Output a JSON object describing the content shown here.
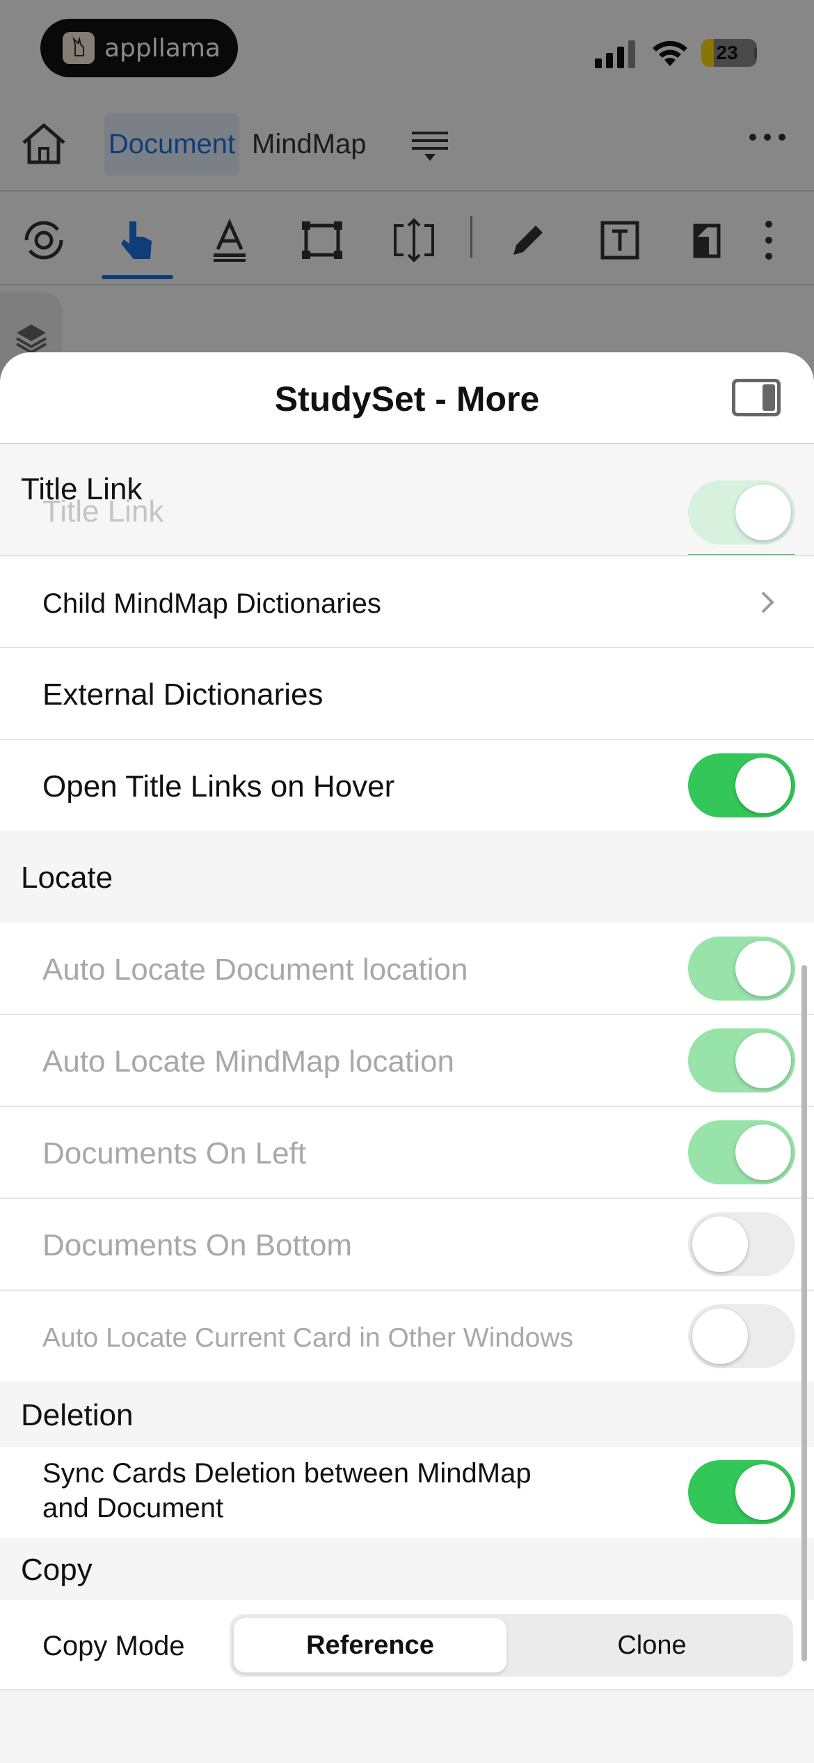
{
  "status": {
    "app_pill": "appllama",
    "battery": "23",
    "colors": {
      "battery_level": "#ffd60a"
    }
  },
  "nav": {
    "tab_document": "Document",
    "tab_mindmap": "MindMap",
    "icons": [
      "home-icon",
      "list-icon",
      "more-icon"
    ]
  },
  "toolbar": {
    "icons": [
      "settings-cycle-icon",
      "pointer-hand-icon",
      "text-highlight-icon",
      "rect-select-icon",
      "resize-icon",
      "pencil-icon",
      "text-box-icon",
      "eraser-icon",
      "more-vertical-icon"
    ],
    "accent": "#1f6fdc"
  },
  "sheet": {
    "title": "StudySet - More",
    "sections": {
      "title_link": "Title Link",
      "locate": "Locate",
      "deletion": "Deletion",
      "copy": "Copy"
    },
    "rows": {
      "title_link_ghost": "Title Link",
      "child_mindmap_dictionaries": "Child MindMap Dictionaries",
      "external_dictionaries": "External Dictionaries",
      "open_title_links_on_hover": "Open Title Links on Hover",
      "auto_locate_document": "Auto Locate Document location",
      "auto_locate_mindmap": "Auto Locate MindMap location",
      "documents_on_left": "Documents On Left",
      "documents_on_bottom": "Documents On Bottom",
      "auto_locate_current_card": "Auto Locate Current Card in Other Windows",
      "sync_cards_deletion_line1": "Sync Cards Deletion between MindMap",
      "sync_cards_deletion_line2": "and Document",
      "copy_mode": "Copy Mode"
    },
    "copy_mode": {
      "options": [
        "Reference",
        "Clone"
      ],
      "selected": "Reference"
    },
    "colors": {
      "toggle_on": "#33c759",
      "toggle_disabled_on": "#97e3aa"
    }
  }
}
